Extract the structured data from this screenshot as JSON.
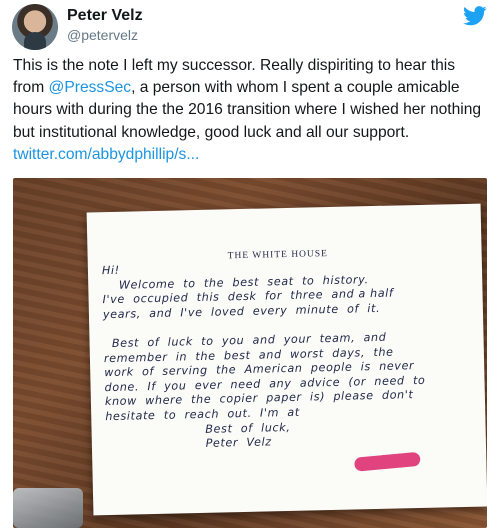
{
  "tweet": {
    "author": {
      "name": "Peter Velz",
      "handle": "@petervelz",
      "avatar_icon": "avatar"
    },
    "platform_icon": "twitter-bird-icon",
    "accent_color": "#1b95e0",
    "text_before_mention": "This is the note I left my successor. Really dispiriting to hear this from ",
    "mention": "@PressSec",
    "text_after_mention": ", a person with whom I spent a couple amicable hours with during the the 2016 transition where I wished her nothing but institutional knowledge, good luck and all our support. ",
    "link": "twitter.com/abbydphillip/s..."
  },
  "card": {
    "title": "THE WHITE HOUSE",
    "lines": [
      "Hi!",
      "    Welcome  to  the  best  seat  to  history.",
      "I've  occupied  this  desk  for  three  and a half",
      "years,  and  I've  loved  every  minute  of  it.",
      "",
      "  Best  of  luck  to  you  and  your  team,  and",
      "remember  in  the  best  and  worst  days,  the",
      "work  of  serving  the  American  people  is  never",
      "done.  If  you  ever  need  any  advice  (or  need  to",
      "know  where  the  copier  paper  is)  please  don't",
      "hesitate  to  reach  out.  I'm  at",
      "                        Best  of  luck,",
      "                        Peter  Velz"
    ]
  }
}
